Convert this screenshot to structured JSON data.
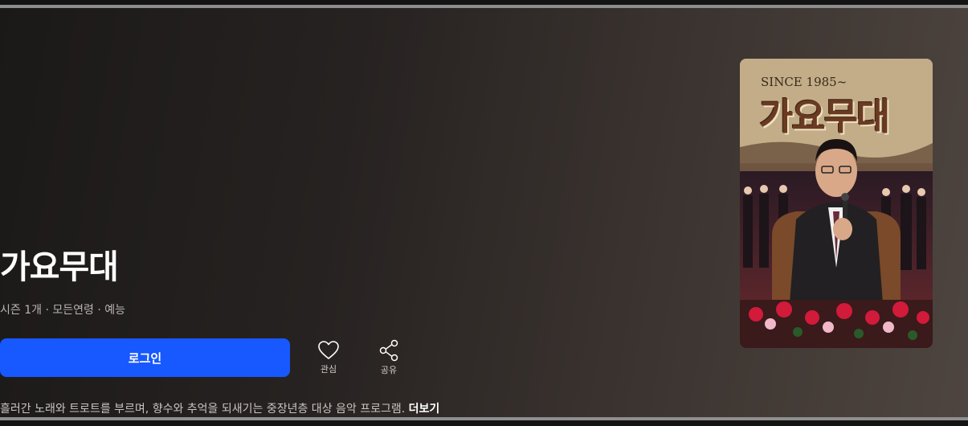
{
  "show": {
    "title": "가요무대",
    "meta": "시즌 1개 · 모든연령 · 예능",
    "description": "흘러간 노래와 트로트를 부르며, 향수와 추억을 되새기는 중장년층 대상 음악 프로그램.",
    "more_label": "더보기"
  },
  "actions": {
    "login_label": "로그인",
    "favorite_label": "관심",
    "share_label": "공유"
  },
  "poster": {
    "since_text": "SINCE 1985~",
    "title_text": "가요무대"
  },
  "icons": {
    "favorite": "heart-icon",
    "share": "share-icon"
  },
  "colors": {
    "primary_button": "#1758ff",
    "background_dark": "#1b1918",
    "background_light": "#4e4540"
  }
}
